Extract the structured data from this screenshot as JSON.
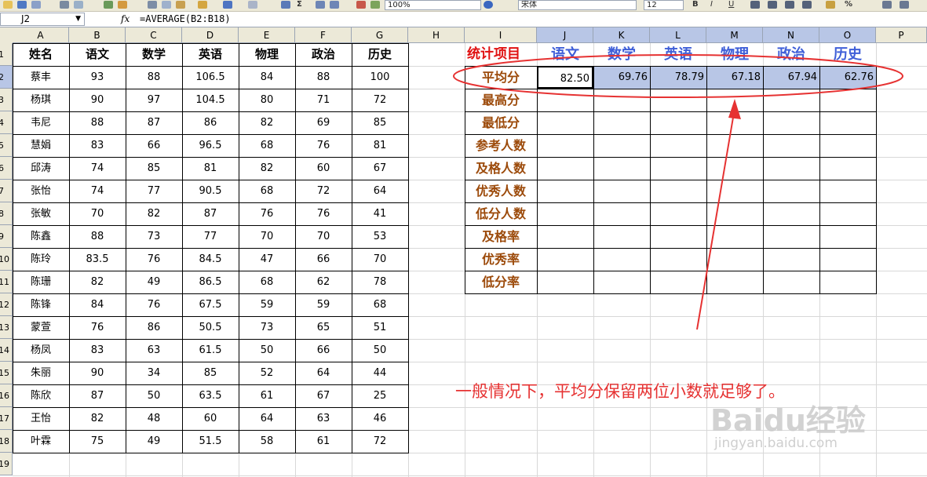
{
  "toolbar": {
    "zoom": "100%",
    "font_name": "宋体",
    "font_size": "12",
    "bold": "B",
    "italic": "I",
    "underline": "U",
    "sum": "Σ",
    "percent": "%"
  },
  "formula_bar": {
    "name_box": "J2",
    "fx": "fx",
    "formula": "=AVERAGE(B2:B18)"
  },
  "sheet": {
    "columns": [
      "A",
      "B",
      "C",
      "D",
      "E",
      "F",
      "G",
      "H",
      "I",
      "J",
      "K",
      "L",
      "M",
      "N",
      "O",
      "P"
    ],
    "selected_columns": [
      "J",
      "K",
      "L",
      "M",
      "N",
      "O"
    ],
    "row_numbers": [
      "1",
      "2",
      "3",
      "4",
      "5",
      "6",
      "7",
      "8",
      "9",
      "10",
      "11",
      "12",
      "13",
      "14",
      "15",
      "16",
      "17",
      "18",
      "19"
    ],
    "selected_row": "2"
  },
  "scores": {
    "headers": [
      "姓名",
      "语文",
      "数学",
      "英语",
      "物理",
      "政治",
      "历史"
    ],
    "rows": [
      [
        "蔡丰",
        "93",
        "88",
        "106.5",
        "84",
        "88",
        "100"
      ],
      [
        "杨琪",
        "90",
        "97",
        "104.5",
        "80",
        "71",
        "72"
      ],
      [
        "韦尼",
        "88",
        "87",
        "86",
        "82",
        "69",
        "85"
      ],
      [
        "慧娟",
        "83",
        "66",
        "96.5",
        "68",
        "76",
        "81"
      ],
      [
        "邱涛",
        "74",
        "85",
        "81",
        "82",
        "60",
        "67"
      ],
      [
        "张怡",
        "74",
        "77",
        "90.5",
        "68",
        "72",
        "64"
      ],
      [
        "张敏",
        "70",
        "82",
        "87",
        "76",
        "76",
        "41"
      ],
      [
        "陈鑫",
        "88",
        "73",
        "77",
        "70",
        "70",
        "53"
      ],
      [
        "陈玲",
        "83.5",
        "76",
        "84.5",
        "47",
        "66",
        "70"
      ],
      [
        "陈珊",
        "82",
        "49",
        "86.5",
        "68",
        "62",
        "78"
      ],
      [
        "陈锋",
        "84",
        "76",
        "67.5",
        "59",
        "59",
        "68"
      ],
      [
        "蒙萱",
        "76",
        "86",
        "50.5",
        "73",
        "65",
        "51"
      ],
      [
        "杨凤",
        "83",
        "63",
        "61.5",
        "50",
        "66",
        "50"
      ],
      [
        "朱丽",
        "90",
        "34",
        "85",
        "52",
        "64",
        "44"
      ],
      [
        "陈欣",
        "87",
        "50",
        "63.5",
        "61",
        "67",
        "25"
      ],
      [
        "王怡",
        "82",
        "48",
        "60",
        "64",
        "63",
        "46"
      ],
      [
        "叶霖",
        "75",
        "49",
        "51.5",
        "58",
        "61",
        "72"
      ]
    ]
  },
  "stats": {
    "title": "统计项目",
    "subjects": [
      "语文",
      "数学",
      "英语",
      "物理",
      "政治",
      "历史"
    ],
    "items": [
      "平均分",
      "最高分",
      "最低分",
      "参考人数",
      "及格人数",
      "优秀人数",
      "低分人数",
      "及格率",
      "优秀率",
      "低分率"
    ],
    "average": [
      "82.50",
      "69.76",
      "78.79",
      "67.18",
      "67.94",
      "62.76"
    ]
  },
  "annotation": {
    "text": "一般情况下，平均分保留两位小数就足够了。",
    "color": "#e63232"
  },
  "watermark": {
    "logo": "Baidu经验",
    "url": "jingyan.baidu.com"
  },
  "colors": {
    "header_bg": "#ece9d8",
    "selection": "#b8c6e6",
    "stat_label": "#9c4a0a",
    "stat_title": "#e01010",
    "stat_subject": "#3f5fd8",
    "annotation": "#e63232"
  }
}
